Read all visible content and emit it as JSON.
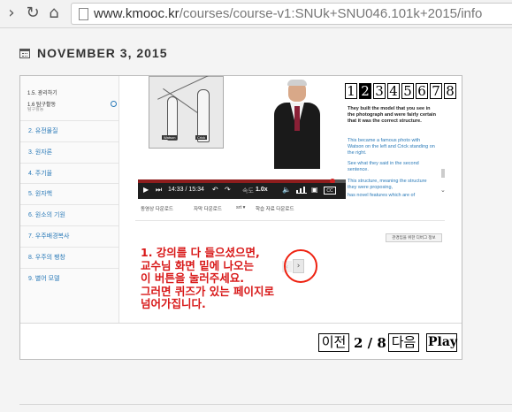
{
  "browser": {
    "url_host": "www.kmooc.kr",
    "url_path": "/courses/course-v1:SNUk+SNU046.101k+2015/info"
  },
  "update": {
    "date": "NOVEMBER 3, 2015"
  },
  "course": {
    "sidebar_subsections": [
      {
        "label": "1.5. 광리하기"
      },
      {
        "label": "1.6 탐구활동",
        "note": "탐구활동"
      }
    ],
    "chapters": [
      "2. 유전물질",
      "3. 원자론",
      "4. 주기율",
      "5. 원자핵",
      "6. 원소의 기원",
      "7. 우주배경복사",
      "8. 우주의 팽창",
      "9. 별어 모델"
    ],
    "video": {
      "tag_left": "Watson",
      "tag_right": "Crick",
      "time": "14:33 / 15:34",
      "speed_label": "속도",
      "speed_value": "1.0x",
      "cc_label": "CC"
    },
    "transcript": [
      "They built the model that you see in the photograph and were fairly certain that it was the correct structure.",
      "This became a famous photo with Watson on the left and Crick standing on the right.",
      "See what they said in the second sentence.",
      "This structure, meaning the structure they were proposing,",
      "has novel features which are of"
    ],
    "downloads": [
      "동영상 다운로드",
      "자막 다운로드",
      "srt",
      "학습 자료 다운로드"
    ],
    "accessibility_button": "관경임을 위한 디버그 정보",
    "instruction": [
      "1. 강의를 다 들으셨으면,",
      "교수님 화면 밑에 나오는",
      "이 버튼을 눌러주세요.",
      "그러면 퀴즈가 있는 페이지로",
      "넘어가집니다."
    ]
  },
  "pager": {
    "pages": [
      "1",
      "2",
      "3",
      "4",
      "5",
      "6",
      "7",
      "8"
    ],
    "active_page": 2
  },
  "slide_nav": {
    "prev_label": "이전",
    "counter": "2 / 8",
    "next_label": "다음",
    "play_label": "Play"
  },
  "colors": {
    "accent_link": "#2a7ab8",
    "annotation_red": "#d81818",
    "progress": "#8e1d1d"
  }
}
